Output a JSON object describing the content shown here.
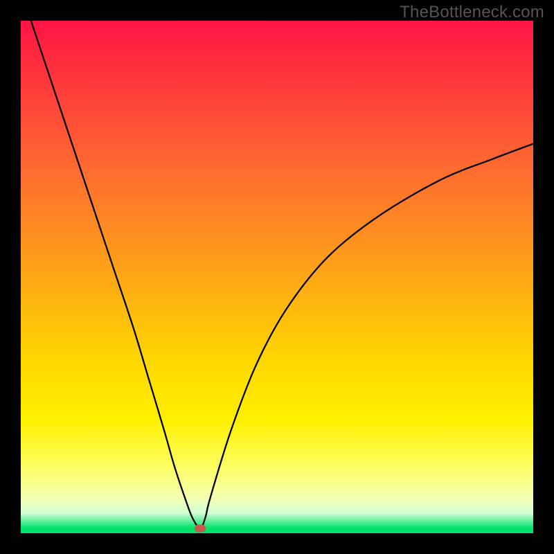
{
  "watermark": "TheBottleneck.com",
  "chart_data": {
    "type": "line",
    "title": "",
    "xlabel": "",
    "ylabel": "",
    "xlim": [
      0,
      100
    ],
    "ylim": [
      0,
      100
    ],
    "grid": false,
    "series": [
      {
        "name": "bottleneck-curve",
        "x": [
          2,
          6,
          10,
          14,
          18,
          22,
          25,
          28,
          30,
          32,
          33.5,
          35,
          36,
          37,
          41,
          46,
          52,
          60,
          70,
          82,
          92,
          100
        ],
        "y": [
          100,
          88,
          76,
          64,
          52,
          40,
          30,
          20,
          13,
          7,
          3,
          1,
          3,
          7,
          20,
          33,
          44,
          54,
          62,
          69,
          73,
          76
        ]
      }
    ],
    "marker": {
      "x": 35,
      "y": 1
    },
    "background_gradient": {
      "orientation": "vertical",
      "stops": [
        {
          "pos": 0,
          "color": "#ff1347"
        },
        {
          "pos": 18,
          "color": "#ff4a38"
        },
        {
          "pos": 42,
          "color": "#ff8f20"
        },
        {
          "pos": 66,
          "color": "#ffd600"
        },
        {
          "pos": 87,
          "color": "#fdff62"
        },
        {
          "pos": 96,
          "color": "#d3ffd6"
        },
        {
          "pos": 100,
          "color": "#00e36b"
        }
      ]
    }
  }
}
